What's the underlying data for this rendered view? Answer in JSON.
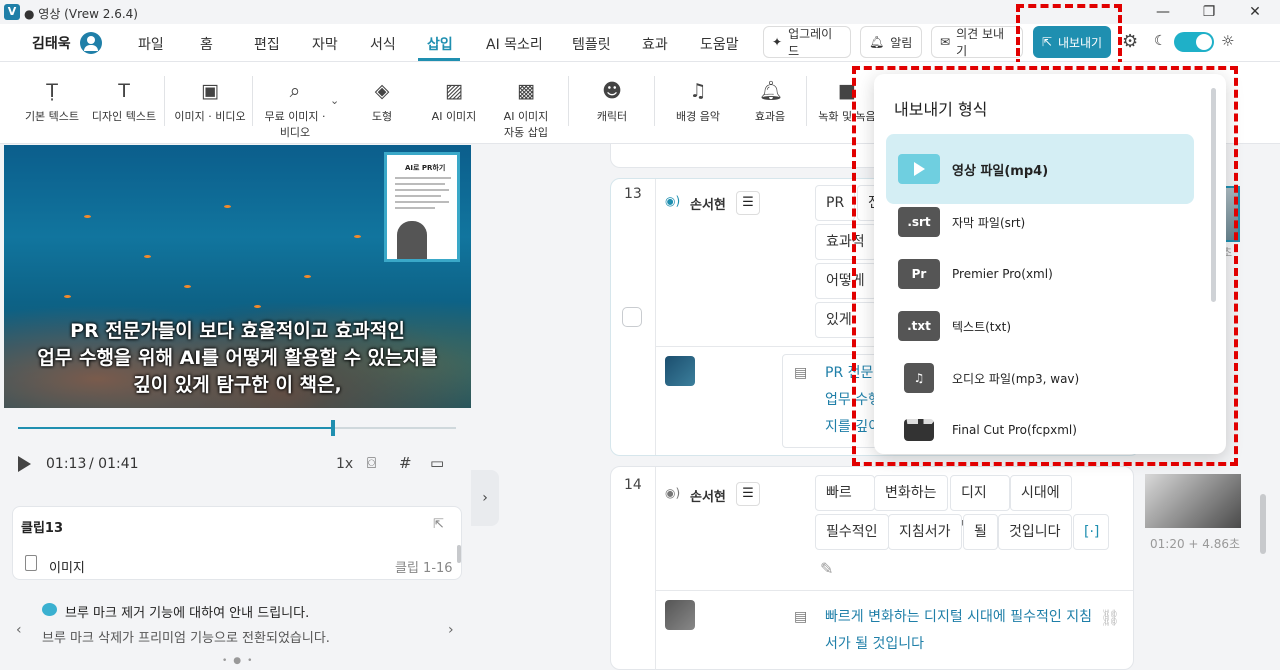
{
  "window": {
    "title": "● 영상 (Vrew 2.6.4)",
    "logo": "V",
    "minimize": "—",
    "maximize": "❐",
    "close": "✕"
  },
  "menubar": {
    "user": "김태욱",
    "items": [
      "파일",
      "홈",
      "편집",
      "자막",
      "서식",
      "삽입",
      "AI 목소리",
      "템플릿",
      "효과",
      "도움말"
    ],
    "active": "삽입",
    "upgrade": "업그레이드",
    "alarm": "알림",
    "feedback": "의견 보내기",
    "export": "내보내기"
  },
  "toolbar": {
    "items": [
      {
        "label": "기본 텍스트",
        "icon": "text-box-icon"
      },
      {
        "label": "디자인 텍스트",
        "icon": "design-text-icon"
      },
      {
        "label": "이미지 · 비디오",
        "icon": "image-icon"
      },
      {
        "label": "무료 이미지 · 비디오",
        "icon": "image-search-icon"
      },
      {
        "label": "도형",
        "icon": "shapes-icon"
      },
      {
        "label": "AI 이미지",
        "icon": "ai-image-icon"
      },
      {
        "label": "AI 이미지 자동 삽입",
        "icon": "ai-image-auto-icon"
      },
      {
        "label": "캐릭터",
        "icon": "character-icon"
      },
      {
        "label": "배경 음악",
        "icon": "music-icon"
      },
      {
        "label": "효과음",
        "icon": "bell-icon"
      },
      {
        "label": "녹화 및 녹음",
        "icon": "record-icon"
      }
    ]
  },
  "video": {
    "book_title": "AI로 PR하기",
    "subtitle": [
      "PR 전문가들이 보다 효율적이고 효과적인",
      "업무 수행을 위해 AI를 어떻게 활용할 수 있는지를",
      "깊이 있게 탐구한 이 책은,"
    ],
    "progress": 0.72
  },
  "player": {
    "current": "01:13",
    "total": "/ 01:41",
    "speed": "1x"
  },
  "clip": {
    "title": "클립13",
    "type": "이미지",
    "range": "클립 1-16"
  },
  "notice": {
    "title": "브루 마크 제거 기능에 대하여 안내 드립니다.",
    "body": "브루 마크 삭제가 프리미엄 기능으로 전환되었습니다."
  },
  "scenes": [
    {
      "num": "13",
      "speaker": "손서현",
      "words_rows": [
        [
          "PR",
          "전"
        ],
        [
          "효과적인"
        ],
        [
          "어떻게"
        ],
        [
          "있게"
        ]
      ],
      "subtitle": [
        "PR 전문",
        "업무 수행",
        "지를 깊이"
      ]
    },
    {
      "num": "14",
      "speaker": "손서현",
      "words_rows": [
        [
          "빠르게",
          "변화하는",
          "디지털",
          "시대에"
        ],
        [
          "필수적인",
          "지침서가",
          "될",
          "것입니다",
          "[·]"
        ]
      ],
      "subtitle": [
        "빠르게 변화하는 디지털 시대에 필수적인 지침",
        "서가 될 것입니다"
      ],
      "time": "01:20 + 4.86초"
    }
  ],
  "export_menu": {
    "title": "내보내기 형식",
    "items": [
      {
        "label": "영상 파일(mp4)",
        "icon": "play-icon",
        "selected": true
      },
      {
        "label": "자막 파일(srt)",
        "icon": ".srt"
      },
      {
        "label": "Premier Pro(xml)",
        "icon": "Pr"
      },
      {
        "label": "텍스트(txt)",
        "icon": ".txt"
      },
      {
        "label": "오디오 파일(mp3, wav)",
        "icon": "♫"
      },
      {
        "label": "Final Cut Pro(fcpxml)",
        "icon": "clapper-icon"
      }
    ]
  },
  "colors": {
    "accent": "#1f8fb0",
    "highlight": "#e10000",
    "selected_bg": "#d4eef4"
  }
}
